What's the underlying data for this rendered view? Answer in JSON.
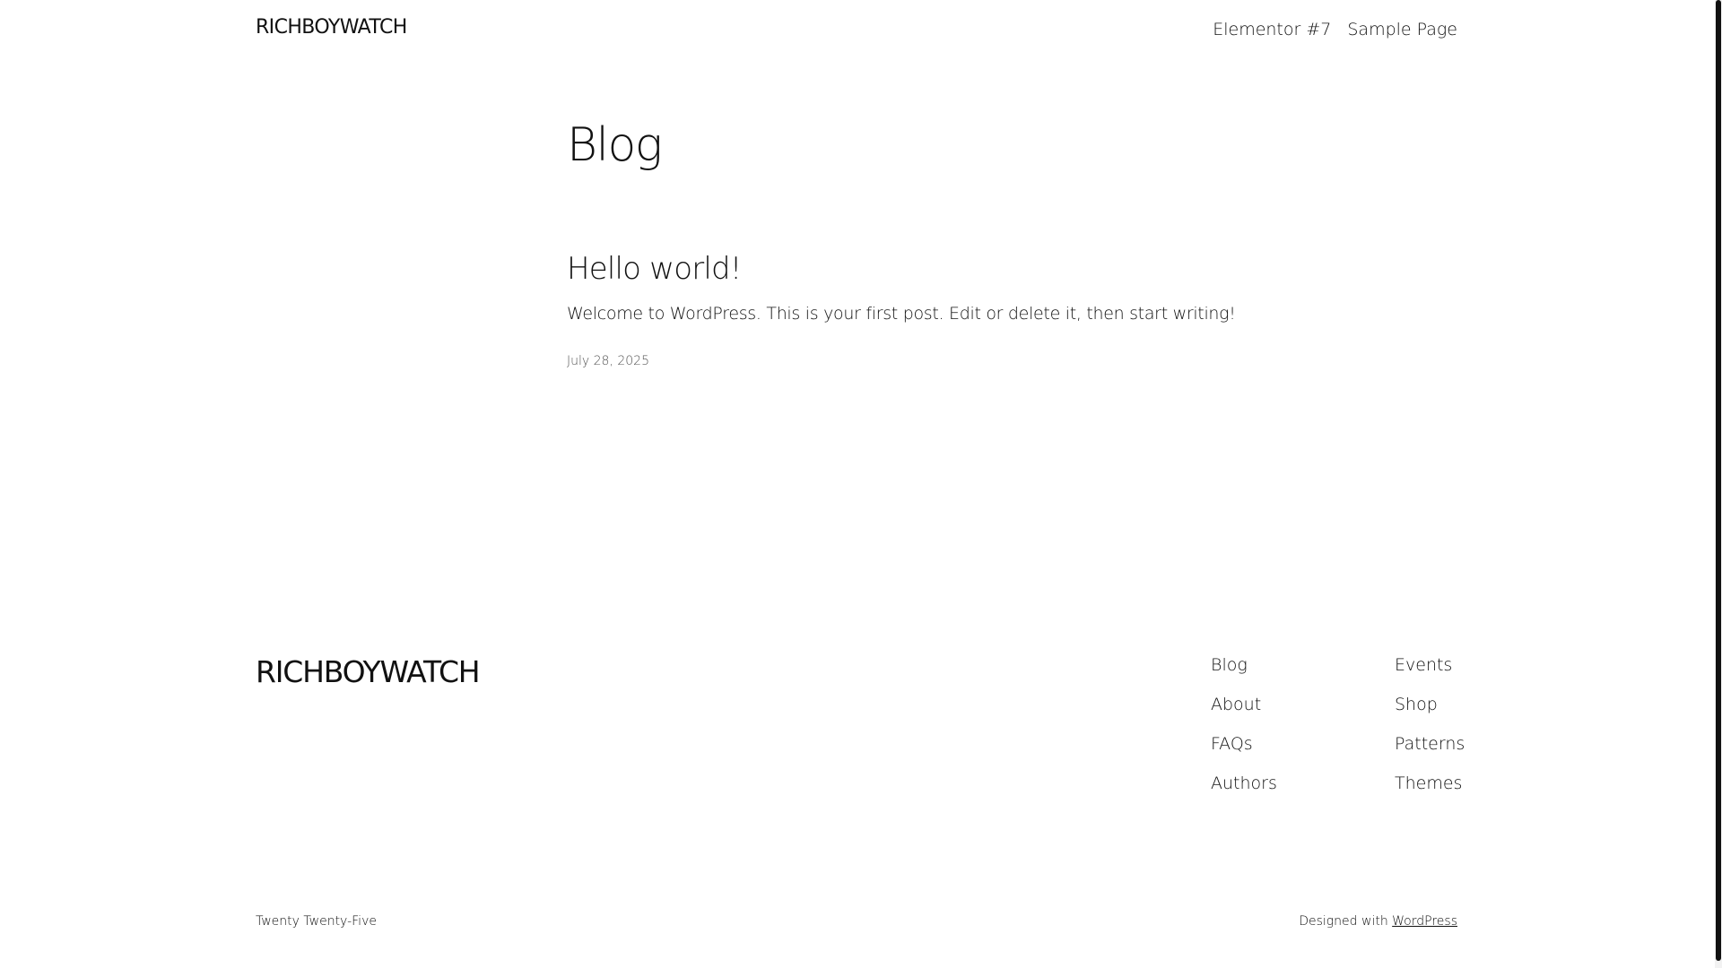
{
  "header": {
    "site_title": "RICHBOYWATCH",
    "nav": [
      {
        "label": "Elementor #7"
      },
      {
        "label": "Sample Page"
      }
    ]
  },
  "main": {
    "page_heading": "Blog",
    "post": {
      "title": "Hello world!",
      "excerpt": "Welcome to WordPress. This is your first post. Edit or delete it, then start writing!",
      "date": "July 28, 2025"
    }
  },
  "footer": {
    "site_title": "RICHBOYWATCH",
    "column_1": [
      {
        "label": "Blog"
      },
      {
        "label": "About"
      },
      {
        "label": "FAQs"
      },
      {
        "label": "Authors"
      }
    ],
    "column_2": [
      {
        "label": "Events"
      },
      {
        "label": "Shop"
      },
      {
        "label": "Patterns"
      },
      {
        "label": "Themes"
      }
    ],
    "theme_name": "Twenty Twenty-Five",
    "credit_prefix": "Designed with",
    "credit_link": "WordPress"
  },
  "colors": {
    "text": "#111111",
    "background": "#ffffff",
    "muted": "#555555"
  }
}
